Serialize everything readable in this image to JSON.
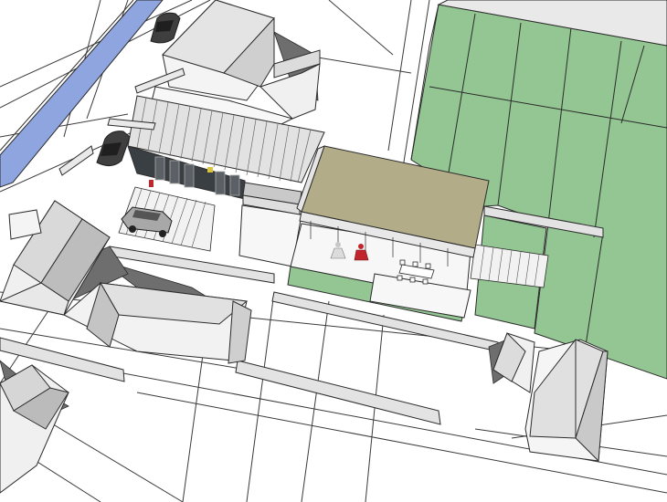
{
  "view": {
    "kind": "3d-axonometric-site-model",
    "background": "#ffffff",
    "colors": {
      "lines": "#2b2b2b",
      "roof_light": "#e6e6e6",
      "roof_mid": "#d9d9d9",
      "wall_shade": "#9a9a9a",
      "shadow": "#6e6e6e",
      "lawn": "#93c692",
      "terrace_roof": "#b3ac89",
      "dark_facade": "#3a3f44",
      "river": "#8fa5df",
      "car": "#4a4a4a",
      "figure_red": "#c0262c"
    },
    "icons": [
      "car-icon",
      "person-icon",
      "dining-table-icon"
    ]
  }
}
